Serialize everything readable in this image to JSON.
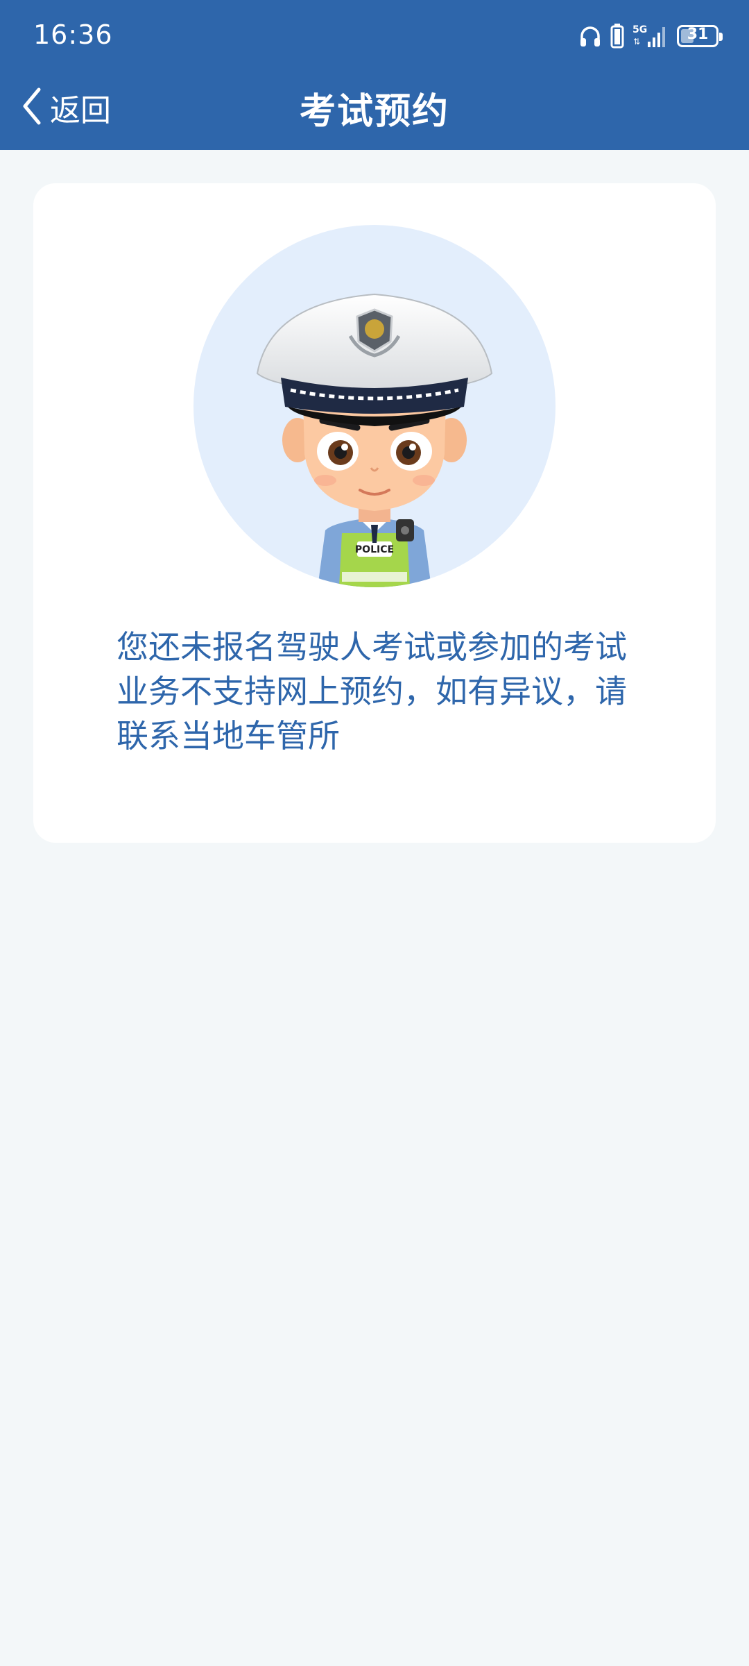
{
  "status_bar": {
    "time": "16:36",
    "network": "5G",
    "battery": "31"
  },
  "nav": {
    "back_label": "返回",
    "title": "考试预约"
  },
  "card": {
    "avatar_badge_text": "POLICE",
    "message": "您还未报名驾驶人考试或参加的考试业务不支持网上预约，如有异议，请联系当地车管所"
  },
  "colors": {
    "header_bg": "#2e66ab",
    "page_bg": "#f3f7f9",
    "text_blue": "#2e66ab",
    "avatar_circle": "#e3eefc"
  }
}
